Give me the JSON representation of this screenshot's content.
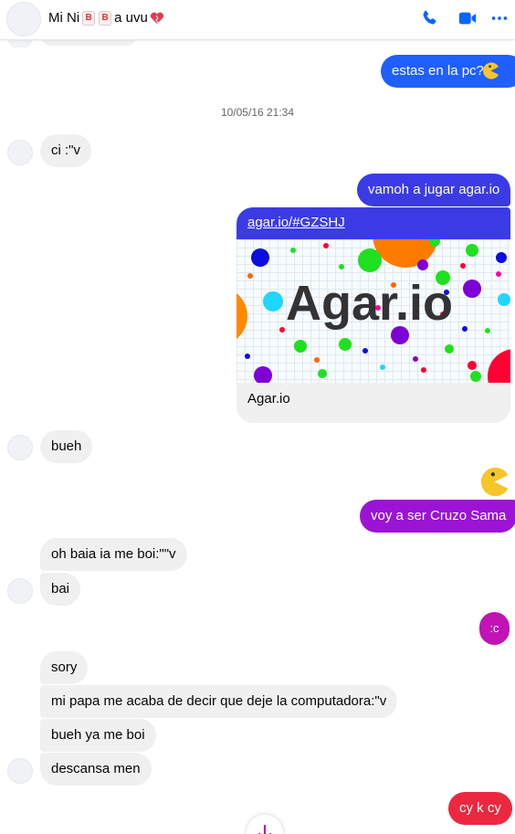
{
  "header": {
    "contact_name_prefix": "Mi Ni",
    "box_char_1": "B",
    "box_char_2": "B",
    "contact_name_suffix": "a uvu",
    "icons": [
      "avatar",
      "phone-icon",
      "video-icon",
      "more-icon"
    ]
  },
  "colors": {
    "accent": "#0866ff",
    "blue_out": "#1f5fff",
    "purple_out": "#9b14d6",
    "magenta_out": "#c213b4",
    "red_out": "#eb2840",
    "incoming": "#f0f0f0"
  },
  "conversation": {
    "m1": "estas en la pc?",
    "timestamp": "10/05/16 21:34",
    "m2": "ci :\"v",
    "m3": "vamoh a jugar agar.io",
    "link_card": {
      "url": "agar.io/#GZSHJ",
      "logo_text": "Agar.io",
      "title": "Agar.io"
    },
    "m4": "bueh",
    "m5": "voy a ser Cruzo Sama",
    "m6": "oh baia ia me boi:\"\"v",
    "m7": "bai",
    "m8": ":c",
    "m9": "sory",
    "m10": "mi papa me acaba de decir que deje la computadora:\"v",
    "m11": "bueh ya me boi",
    "m12": "descansa men",
    "m13": "cy k cy"
  }
}
